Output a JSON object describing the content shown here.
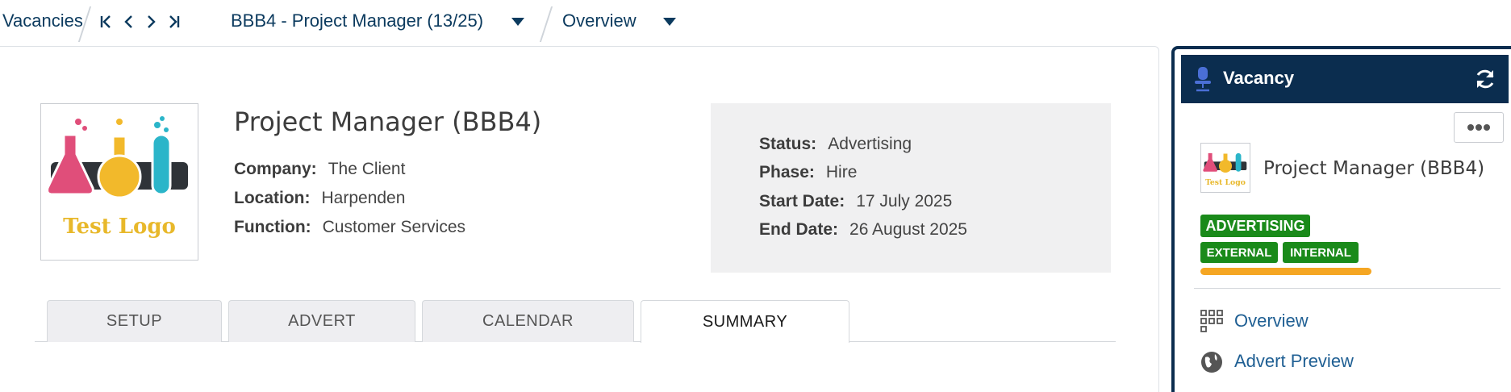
{
  "breadcrumb": {
    "root": "Vacancies",
    "record": "BBB4 - Project Manager (13/25)",
    "view": "Overview"
  },
  "vacancy": {
    "title": "Project Manager (BBB4)",
    "logo_text": "Test Logo",
    "fields": [
      {
        "label": "Company:",
        "value": "The Client"
      },
      {
        "label": "Location:",
        "value": "Harpenden"
      },
      {
        "label": "Function:",
        "value": "Customer Services"
      }
    ],
    "status": [
      {
        "label": "Status:",
        "value": "Advertising"
      },
      {
        "label": "Phase:",
        "value": "Hire"
      },
      {
        "label": "Start Date:",
        "value": "17 July 2025"
      },
      {
        "label": "End Date:",
        "value": "26 August 2025"
      }
    ]
  },
  "tabs": [
    {
      "label": "SETUP"
    },
    {
      "label": "ADVERT"
    },
    {
      "label": "CALENDAR"
    },
    {
      "label": "SUMMARY"
    }
  ],
  "active_tab": "SUMMARY",
  "right_panel": {
    "header": "Vacancy",
    "job_title": "Project Manager (BBB4)",
    "logo_text": "Test Logo",
    "status_badge": "ADVERTISING",
    "tags": [
      "EXTERNAL",
      "INTERNAL"
    ],
    "links": [
      {
        "label": "Overview",
        "icon": "grid-icon"
      },
      {
        "label": "Advert Preview",
        "icon": "globe-icon"
      }
    ]
  },
  "colors": {
    "navy": "#0b2d4f",
    "link": "#1f5f93",
    "badge_green": "#1a8a1a",
    "progress_orange": "#f5a623",
    "status_box_bg": "#f0f0f1"
  },
  "icons": [
    "first-page-icon",
    "prev-icon",
    "next-icon",
    "last-page-icon",
    "chevron-down-icon",
    "office-chair-icon",
    "refresh-icon",
    "more-dots-icon",
    "grid-icon",
    "globe-icon"
  ]
}
